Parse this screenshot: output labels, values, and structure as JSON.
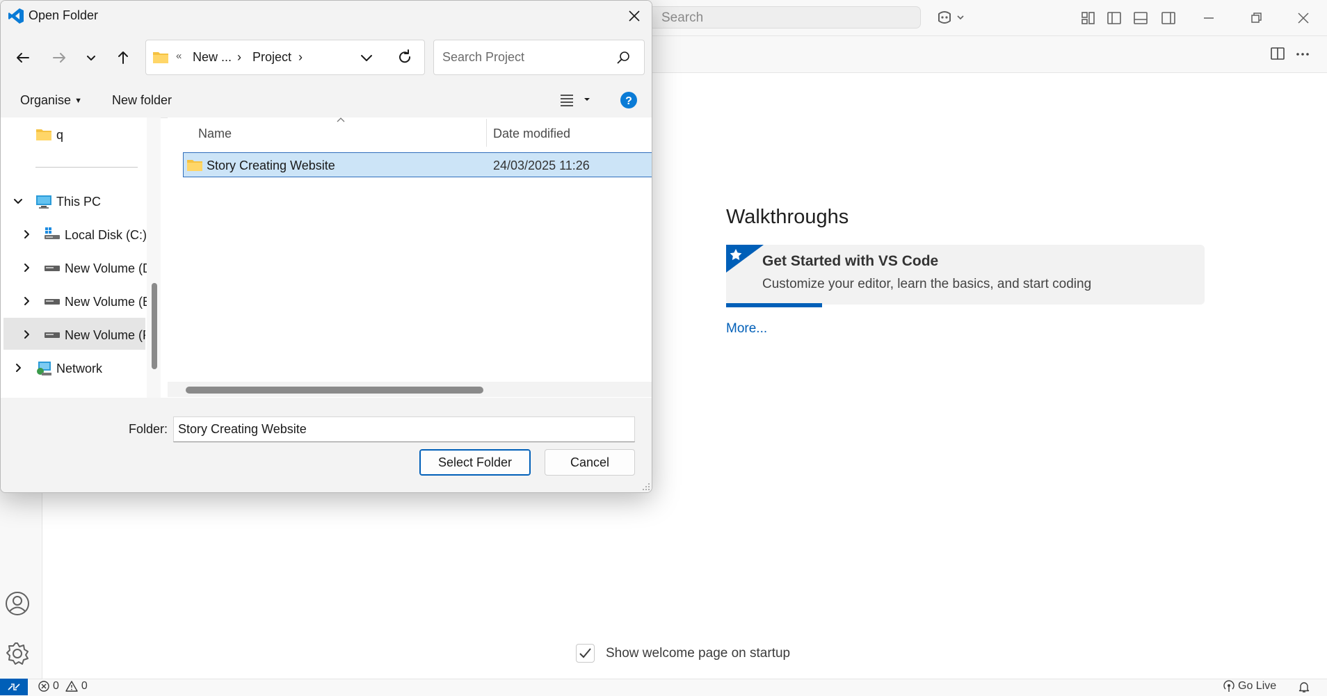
{
  "vscode": {
    "search_placeholder": "Search",
    "walkthroughs_title": "Walkthroughs",
    "walkthrough_card": {
      "title": "Get Started with VS Code",
      "description": "Customize your editor, learn the basics, and start coding",
      "progress_fraction": 0.2
    },
    "more_link": "More...",
    "show_welcome_label": "Show welcome page on startup",
    "show_welcome_checked": true,
    "status": {
      "errors": "0",
      "warnings": "0",
      "go_live": "Go Live"
    },
    "accent_color": "#005fb8"
  },
  "dialog": {
    "title": "Open Folder",
    "breadcrumb": {
      "prefix": "«",
      "items": [
        "New ...",
        "Project"
      ]
    },
    "search_placeholder": "Search Project",
    "toolbar": {
      "organise": "Organise",
      "new_folder": "New folder"
    },
    "nav_tree": {
      "folder_q": "q",
      "this_pc": "This PC",
      "local_disk": "Local Disk (C:)",
      "vol_d": "New Volume (D",
      "vol_e": "New Volume (E",
      "vol_f": "New Volume (F",
      "network": "Network"
    },
    "columns": {
      "name": "Name",
      "date_modified": "Date modified"
    },
    "files": [
      {
        "name": "Story Creating Website",
        "date": "24/03/2025 11:26",
        "selected": true
      }
    ],
    "folder_label": "Folder:",
    "folder_value": "Story Creating Website",
    "select_button": "Select Folder",
    "cancel_button": "Cancel",
    "icons": [
      "back-icon",
      "forward-icon",
      "recent-locations-icon",
      "up-icon",
      "folder-icon",
      "refresh-icon",
      "search-icon",
      "view-options-icon",
      "help-icon",
      "close-icon"
    ]
  }
}
